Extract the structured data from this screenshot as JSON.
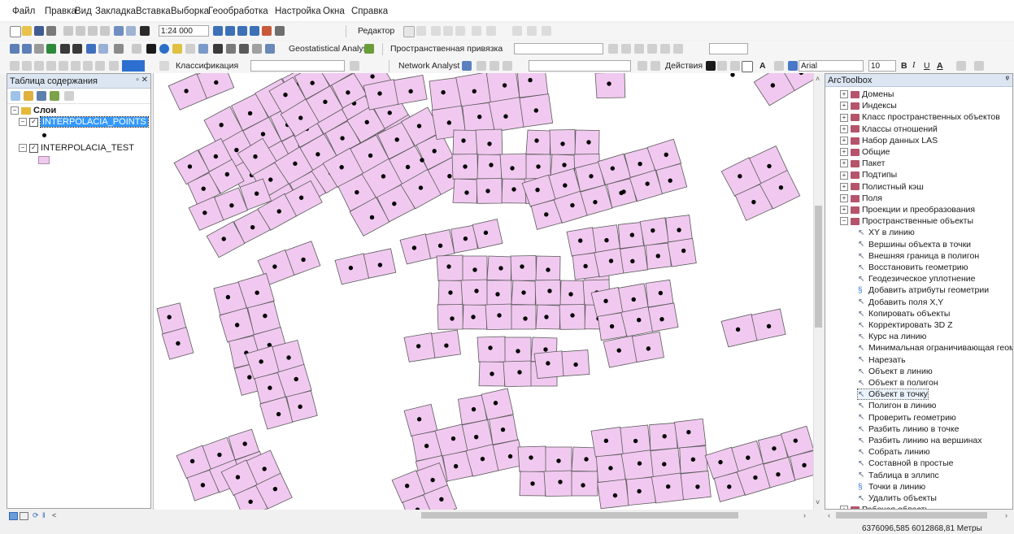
{
  "menu": [
    "Файл",
    "Правка",
    "Вид",
    "Закладка",
    "Вставка",
    "Выборка",
    "Геообработка",
    "Настройка",
    "Окна",
    "Справка"
  ],
  "toolbar1": {
    "scale": "1:24 000",
    "editor_label": "Редактор"
  },
  "toolbar2": {
    "geostat_label": "Geostatistical Analyst",
    "spatial_adj_label": "Пространственная привязка"
  },
  "toolbar3": {
    "classification_label": "Классификация",
    "network_label": "Network Analyst",
    "actions_label": "Действия",
    "font_name": "Arial",
    "font_size": "10",
    "bold": "B",
    "italic": "I",
    "underline": "U"
  },
  "toc": {
    "title": "Таблица содержания",
    "root_label": "Слои",
    "layers": [
      {
        "name": "INTERPOLACIA_POINTS",
        "checked": true,
        "selected": true
      },
      {
        "name": "INTERPOLACIA_TEST",
        "checked": true,
        "selected": false
      }
    ]
  },
  "toolbox": {
    "title": "ArcToolbox",
    "groups_top": [
      "Домены",
      "Индексы",
      "Класс пространственных объектов",
      "Классы отношений",
      "Набор данных LAS",
      "Общие",
      "Пакет",
      "Подтипы",
      "Полистный кэш",
      "Поля",
      "Проекции и преобразования"
    ],
    "expanded_group": "Пространственные объекты",
    "tools": [
      "XY в линию",
      "Вершины объекта в точки",
      "Внешняя граница в полигон",
      "Восстановить геометрию",
      "Геодезическое уплотнение",
      "Добавить атрибуты геометрии",
      "Добавить поля X,Y",
      "Копировать объекты",
      "Корректировать 3D Z",
      "Курс на линию",
      "Минимальная ограничивающая геом",
      "Нарезать",
      "Объект в линию",
      "Объект в полигон",
      "Объект в точку",
      "Полигон в линию",
      "Проверить геометрию",
      "Разбить линию в точке",
      "Разбить линию на вершинах",
      "Собрать линию",
      "Составной в простые",
      "Таблица в эллипс",
      "Точки в линию",
      "Удалить объекты"
    ],
    "script_tools": [
      "Добавить атрибуты геометрии",
      "Точки в линию"
    ],
    "selected_tool": "Объект в точку",
    "group_after": "Рабочая область"
  },
  "status": {
    "coordinates": "6376096,585  6012868,81 Метры"
  },
  "colors": {
    "polygon_fill": "#f1c9f0",
    "polygon_stroke": "#5a5a5a",
    "point": "#000000",
    "selection": "#3399ff"
  }
}
